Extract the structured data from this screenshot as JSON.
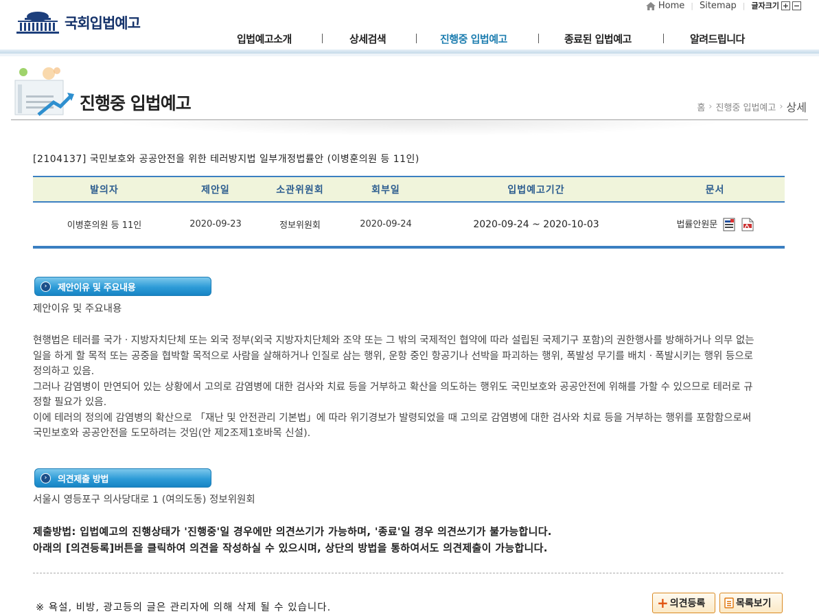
{
  "util": {
    "home": "Home",
    "sitemap": "Sitemap",
    "font_size": "글자크기",
    "plus": "+",
    "minus": "−"
  },
  "logo": {
    "text": "국회입법예고"
  },
  "gnb": [
    {
      "label": "입법예고소개"
    },
    {
      "label": "상세검색"
    },
    {
      "label": "진행중 입법예고"
    },
    {
      "label": "종료된 입법예고"
    },
    {
      "label": "알려드립니다"
    }
  ],
  "subhead": {
    "title": "진행중 입법예고",
    "crumbs": [
      "홈",
      "진행중 입법예고",
      "상세"
    ]
  },
  "bill": {
    "title": "[2104137] 국민보호와 공공안전을 위한 테러방지법 일부개정법률안 (이병훈의원 등 11인)"
  },
  "table": {
    "headers": [
      "발의자",
      "제안일",
      "소관위원회",
      "회부일",
      "입법예고기간",
      "문서"
    ],
    "row": {
      "proposer": "이병훈의원 등 11인",
      "proposal_date": "2020-09-23",
      "committee": "정보위원회",
      "referral_date": "2020-09-24",
      "period": "2020-09-24 ~ 2020-10-03",
      "document": "법률안원문"
    }
  },
  "sections": {
    "reason_badge": "제안이유 및 주요내용",
    "reason_label": "제안이유 및 주요내용",
    "reason_paragraphs": [
      "현행법은 테러를 국가ㆍ지방자치단체 또는 외국 정부(외국 지방자치단체와 조약 또는 그 밖의 국제적인 협약에 따라 설립된 국제기구 포함)의 권한행사를 방해하거나 의무 없는 일을 하게 할 목적 또는 공중을 협박할 목적으로 사람을 살해하거나 인질로 삼는 행위, 운항 중인 항공기나 선박을 파괴하는 행위, 폭발성 무기를 배치ㆍ폭발시키는 행위 등으로 정의하고 있음.",
      "그러나 감염병이 만연되어 있는 상황에서 고의로 감염병에 대한 검사와 치료 등을 거부하고 확산을 의도하는 행위도 국민보호와 공공안전에 위해를 가할 수 있으므로 테러로 규정할 필요가 있음.",
      "이에 테러의 정의에 감염병의 확산으로 「재난 및 안전관리 기본법」에 따라 위기경보가 발령되었을 때 고의로 감염병에 대한 검사와 치료 등을 거부하는 행위를 포함함으로써 국민보호와 공공안전을 도모하려는 것임(안 제2조제1호바목 신설)."
    ],
    "opinion_badge": "의견제출 방법",
    "address": "서울시 영등포구 의사당대로 1 (여의도동) 정보위원회",
    "method_line1": "제출방법: 입법예고의 진행상태가 '진행중'일 경우에만 의견쓰기가 가능하며, '종료'일 경우 의견쓰기가 불가능합니다.",
    "method_line2": "아래의 [의견등록]버튼을 클릭하여 의견을 작성하실 수 있으시며, 상단의 방법을 통하여서도 의견제출이 가능합니다."
  },
  "footer": {
    "notice": "※ 욕설, 비방, 광고등의 글은 관리자에 의해 삭제 될 수 있습니다.",
    "register_button": "의견등록",
    "list_button": "목록보기"
  }
}
